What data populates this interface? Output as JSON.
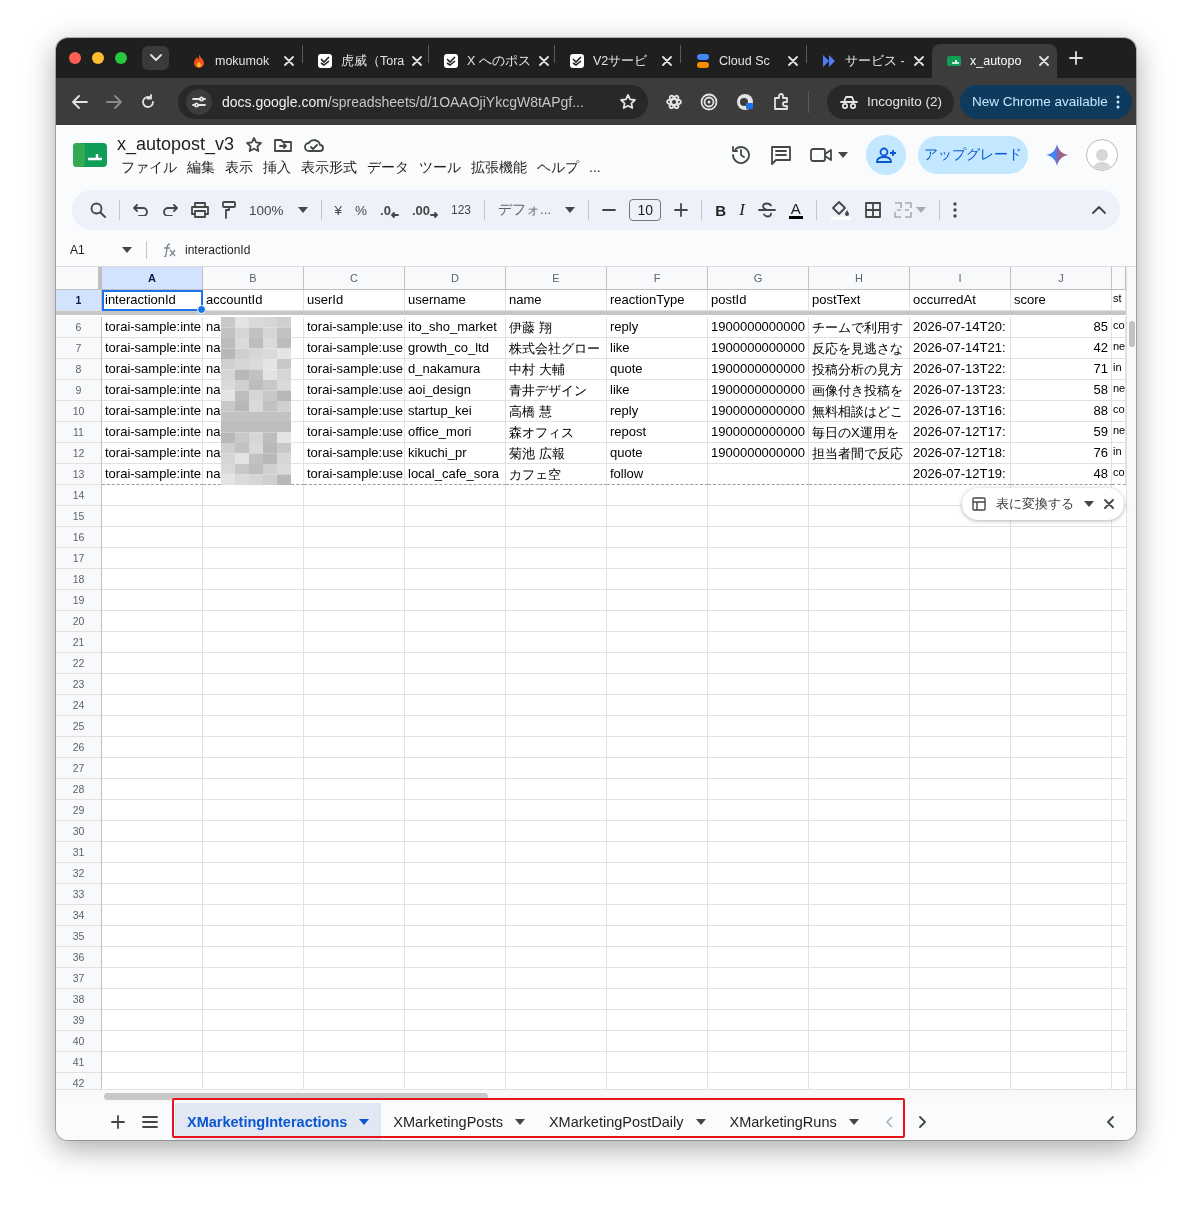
{
  "browser": {
    "tabs": [
      {
        "title": "mokumok",
        "kind": "fire",
        "selected": false
      },
      {
        "title": "虎威（Tora",
        "kind": "badge",
        "selected": false
      },
      {
        "title": "X へのポス",
        "kind": "badge",
        "selected": false
      },
      {
        "title": "V2サービ",
        "kind": "badge",
        "selected": false
      },
      {
        "title": "Cloud Sc",
        "kind": "stack",
        "selected": false
      },
      {
        "title": "サービス -",
        "kind": "chevrons",
        "selected": false
      },
      {
        "title": "x_autopo",
        "kind": "sheets",
        "selected": true
      }
    ],
    "url_host": "docs.google.com",
    "url_path": "/spreadsheets/d/1OAAOjiYkcgW8tAPgf...",
    "incognito": "Incognito (2)",
    "update_button": "New Chrome available"
  },
  "document": {
    "title": "x_autopost_v3",
    "menus": [
      "ファイル",
      "編集",
      "表示",
      "挿入",
      "表示形式",
      "データ",
      "ツール",
      "拡張機能",
      "ヘルプ",
      "..."
    ],
    "upgrade_button": "アップグレード"
  },
  "toolbar": {
    "zoom": "100%",
    "currency": "¥",
    "percent": "%",
    "decrease_decimal": ".0",
    "increase_decimal": ".00",
    "number_format": "123",
    "font": "デフォ...",
    "font_size": "10",
    "bold": "B",
    "italic": "I",
    "text_color": "A"
  },
  "formula_bar": {
    "cell_ref": "A1",
    "value": "interactionId"
  },
  "grid": {
    "columns": [
      {
        "letter": "A",
        "selected": true
      },
      {
        "letter": "B",
        "selected": false,
        "redacted": true
      },
      {
        "letter": "C",
        "selected": false
      },
      {
        "letter": "D",
        "selected": false
      },
      {
        "letter": "E",
        "selected": false
      },
      {
        "letter": "F",
        "selected": false
      },
      {
        "letter": "G",
        "selected": false
      },
      {
        "letter": "H",
        "selected": false
      },
      {
        "letter": "I",
        "selected": false
      },
      {
        "letter": "J",
        "selected": false,
        "numeric": true
      },
      {
        "selected": false
      }
    ],
    "header_row": {
      "number": "1",
      "selected": true,
      "cells": [
        "interactionId",
        "accountId",
        "userId",
        "username",
        "name",
        "reactionType",
        "postId",
        "postText",
        "occurredAt",
        "score",
        "st"
      ]
    },
    "rows": [
      {
        "number": "6",
        "cells": [
          "torai-sample:inte",
          "na",
          "torai-sample:use",
          "ito_sho_market",
          "伊藤 翔",
          "reply",
          "1900000000000",
          "チームで利用す",
          "2026-07-14T20:",
          "85",
          "co"
        ]
      },
      {
        "number": "7",
        "cells": [
          "torai-sample:inte",
          "na",
          "torai-sample:use",
          "growth_co_ltd",
          "株式会社グロー",
          "like",
          "1900000000000",
          "反応を見逃さな",
          "2026-07-14T21:",
          "42",
          "ne"
        ]
      },
      {
        "number": "8",
        "cells": [
          "torai-sample:inte",
          "na",
          "torai-sample:use",
          "d_nakamura",
          "中村 大輔",
          "quote",
          "1900000000000",
          "投稿分析の見方",
          "2026-07-13T22:",
          "71",
          "in"
        ]
      },
      {
        "number": "9",
        "cells": [
          "torai-sample:inte",
          "na",
          "torai-sample:use",
          "aoi_design",
          "青井デザイン",
          "like",
          "1900000000000",
          "画像付き投稿を",
          "2026-07-13T23:",
          "58",
          "ne"
        ]
      },
      {
        "number": "10",
        "cells": [
          "torai-sample:inte",
          "na",
          "torai-sample:use",
          "startup_kei",
          "高橋 慧",
          "reply",
          "1900000000000",
          "無料相談はどこ",
          "2026-07-13T16:",
          "88",
          "co"
        ]
      },
      {
        "number": "11",
        "cells": [
          "torai-sample:inte",
          "na",
          "torai-sample:use",
          "office_mori",
          "森オフィス",
          "repost",
          "1900000000000",
          "毎日のX運用を",
          "2026-07-12T17:",
          "59",
          "ne"
        ]
      },
      {
        "number": "12",
        "cells": [
          "torai-sample:inte",
          "na",
          "torai-sample:use",
          "kikuchi_pr",
          "菊池 広報",
          "quote",
          "1900000000000",
          "担当者間で反応",
          "2026-07-12T18:",
          "76",
          "in"
        ]
      },
      {
        "number": "13",
        "cells": [
          "torai-sample:inte",
          "na",
          "torai-sample:use",
          "local_cafe_sora",
          "カフェ空",
          "follow",
          null,
          null,
          "2026-07-12T19:",
          "48",
          "co"
        ]
      }
    ],
    "empty_rows": [
      "14",
      "15",
      "16",
      "17",
      "18",
      "19",
      "20",
      "21",
      "22",
      "23",
      "24",
      "25",
      "26",
      "27",
      "28",
      "29",
      "30",
      "31",
      "32",
      "33",
      "34",
      "35",
      "36",
      "37",
      "38",
      "39",
      "40",
      "41",
      "42"
    ]
  },
  "convert_chip": {
    "label": "表に変換する"
  },
  "sheet_tabs": [
    {
      "label": "XMarketingInteractions",
      "selected": true
    },
    {
      "label": "XMarketingPosts",
      "selected": false
    },
    {
      "label": "XMarketingPostDaily",
      "selected": false
    },
    {
      "label": "XMarketingRuns",
      "selected": false
    }
  ],
  "sheet_tabs_highlighted": true
}
